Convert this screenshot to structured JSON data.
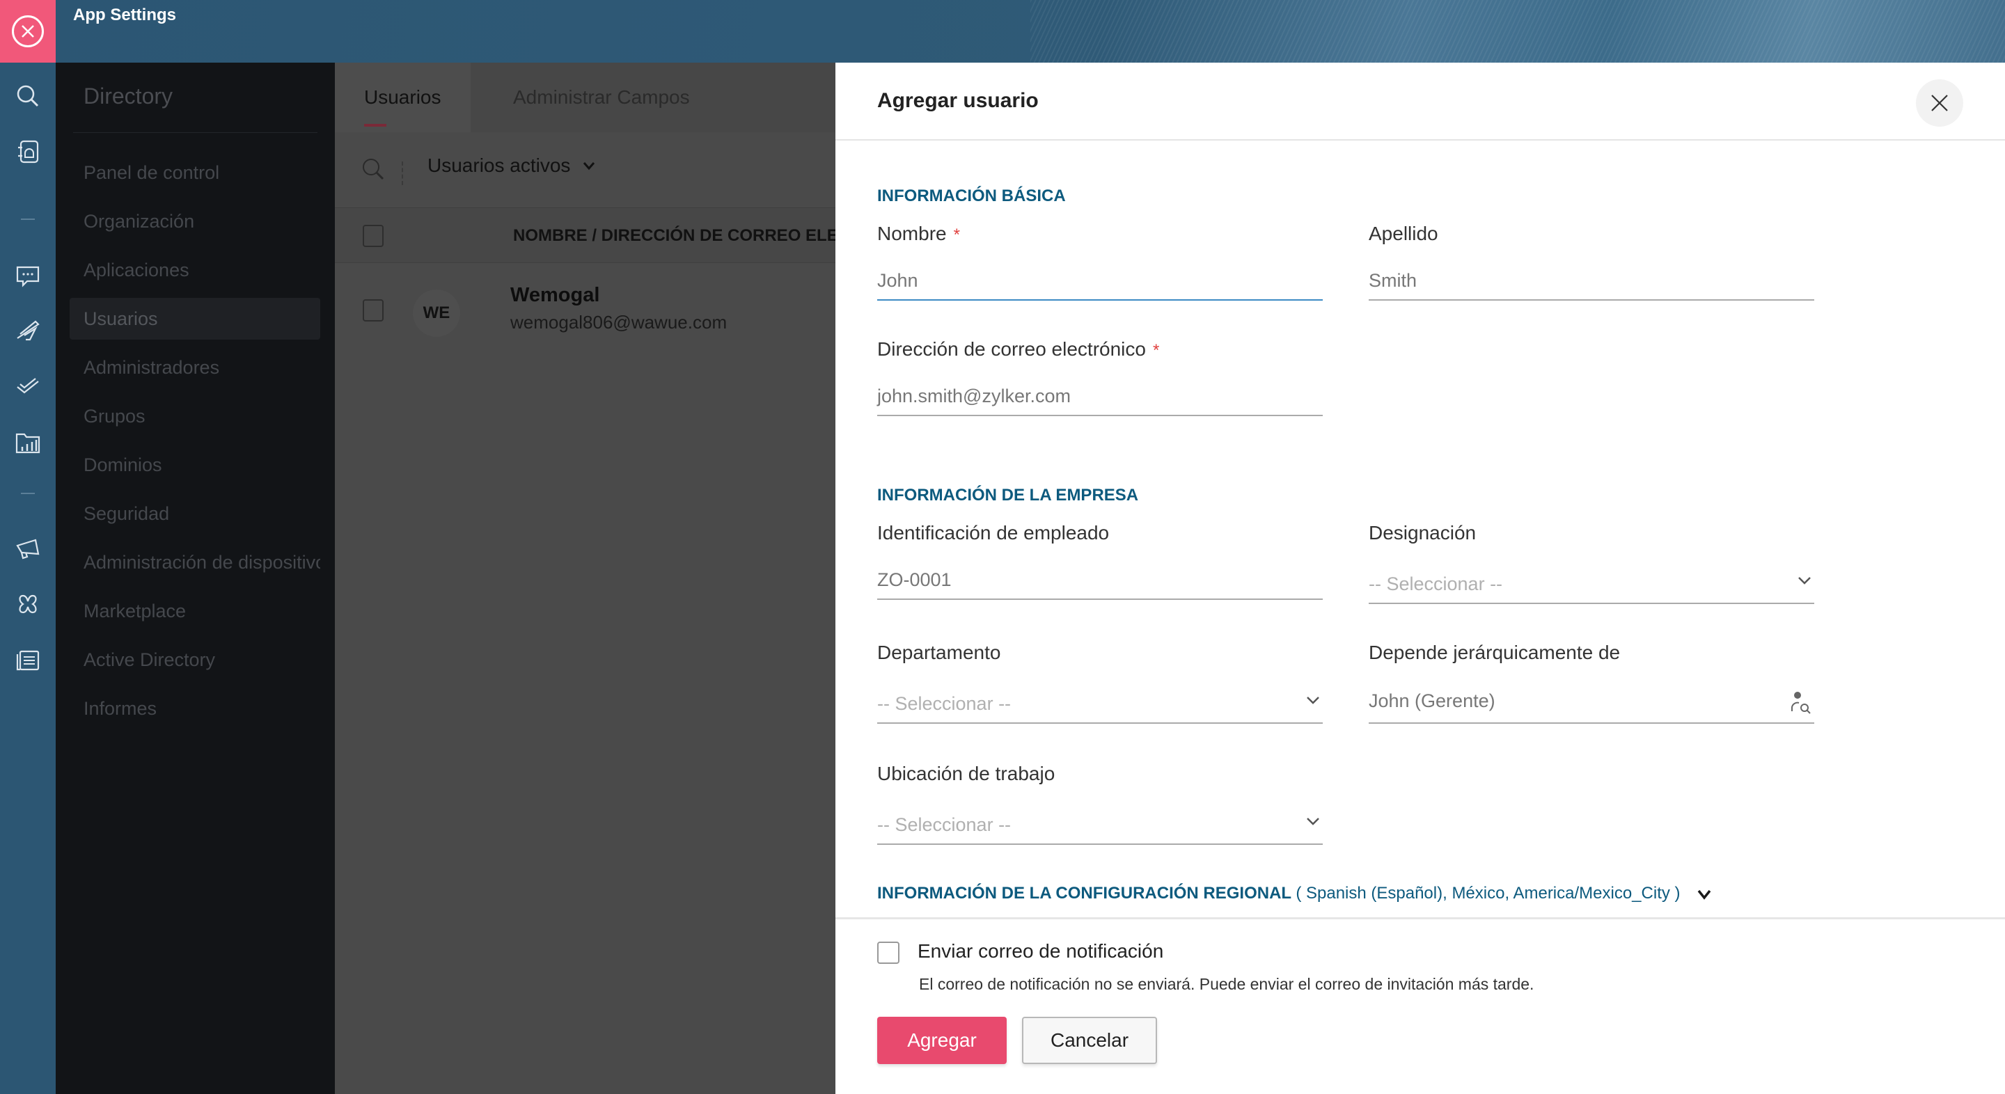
{
  "app": {
    "title": "App Settings",
    "close_icon": "close-circle-icon"
  },
  "rail": {
    "icons": [
      "search-icon",
      "address-book-icon",
      "chat-icon",
      "plane-icon",
      "checkmarks-icon",
      "folder-chart-icon",
      "megaphone-icon",
      "puzzle-icon",
      "documents-icon"
    ]
  },
  "sidebar": {
    "title": "Directory",
    "items": [
      {
        "label": "Panel de control"
      },
      {
        "label": "Organización"
      },
      {
        "label": "Aplicaciones"
      },
      {
        "label": "Usuarios",
        "active": true
      },
      {
        "label": "Administradores"
      },
      {
        "label": "Grupos"
      },
      {
        "label": "Dominios"
      },
      {
        "label": "Seguridad"
      },
      {
        "label": "Administración de dispositivos"
      },
      {
        "label": "Marketplace"
      },
      {
        "label": "Active Directory"
      },
      {
        "label": "Informes"
      }
    ]
  },
  "main": {
    "tabs": [
      {
        "label": "Usuarios",
        "active": true
      },
      {
        "label": "Administrar Campos"
      }
    ],
    "filter": {
      "label": "Usuarios activos"
    },
    "table": {
      "columns": [
        "NOMBRE / DIRECCIÓN DE CORREO ELECTRÓNICO"
      ],
      "rows": [
        {
          "initials": "WE",
          "name": "Wemogal",
          "email": "wemogal806@wawue.com"
        }
      ]
    }
  },
  "modal": {
    "title": "Agregar usuario",
    "sections": {
      "basic": "INFORMACIÓN BÁSICA",
      "company": "INFORMACIÓN DE LA EMPRESA",
      "regional": "INFORMACIÓN DE LA CONFIGURACIÓN REGIONAL",
      "regional_summary": "( Spanish (Español), México, America/Mexico_City )"
    },
    "fields": {
      "first_name": {
        "label": "Nombre",
        "required": true,
        "placeholder": "John"
      },
      "last_name": {
        "label": "Apellido",
        "placeholder": "Smith"
      },
      "email": {
        "label": "Dirección de correo electrónico",
        "required": true,
        "placeholder": "john.smith@zylker.com"
      },
      "employee_id": {
        "label": "Identificación de empleado",
        "placeholder": "ZO-0001"
      },
      "designation": {
        "label": "Designación",
        "value": "-- Seleccionar --"
      },
      "department": {
        "label": "Departamento",
        "value": "-- Seleccionar --"
      },
      "reports_to": {
        "label": "Depende jerárquicamente de",
        "placeholder": "John (Gerente)"
      },
      "work_location": {
        "label": "Ubicación de trabajo",
        "value": "-- Seleccionar --"
      }
    },
    "required_mark": "*",
    "footer": {
      "send_notification_label": "Enviar correo de notificación",
      "send_notification_checked": false,
      "hint": "El correo de notificación no se enviará. Puede enviar el correo de invitación más tarde.",
      "add_label": "Agregar",
      "cancel_label": "Cancelar"
    }
  },
  "colors": {
    "accent": "#e84a6e",
    "topbar": "#2c5673",
    "section_heading": "#0d5a7e",
    "focus": "#3d8bc4"
  }
}
